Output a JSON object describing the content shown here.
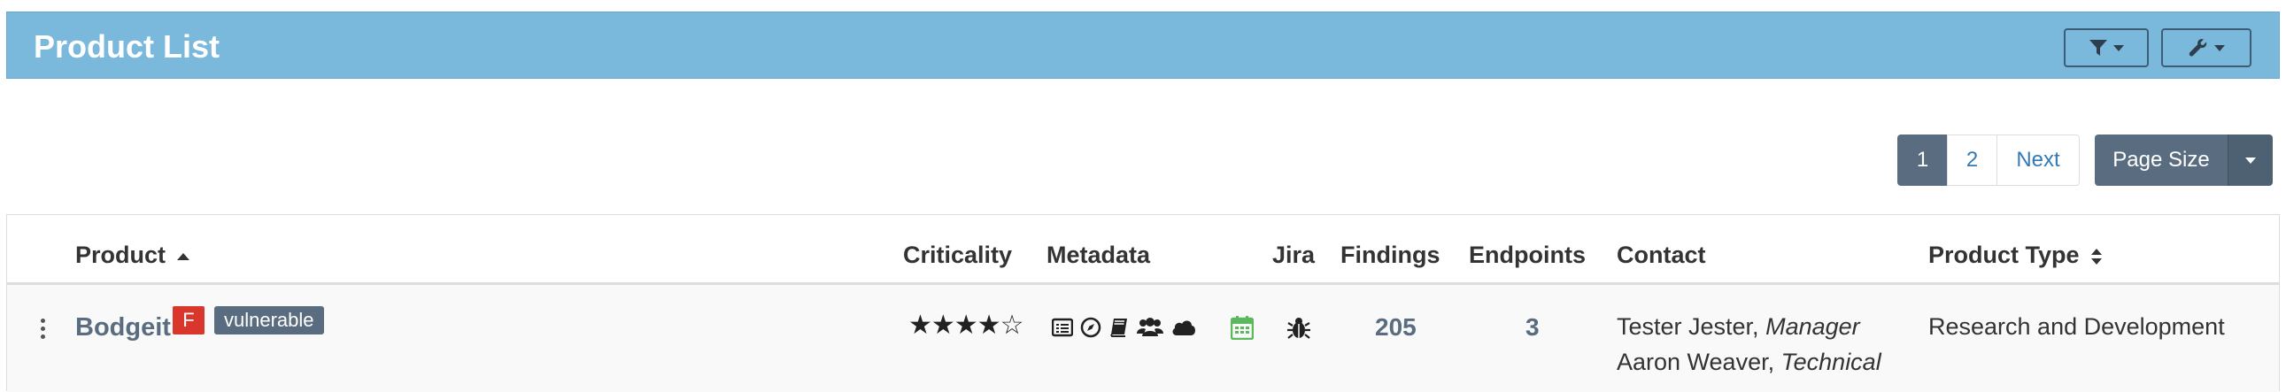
{
  "header": {
    "title": "Product List",
    "filter_icon": "filter-icon",
    "wrench_icon": "wrench-icon"
  },
  "pagination": {
    "pages": [
      "1",
      "2"
    ],
    "current": "1",
    "next_label": "Next",
    "page_size_label": "Page Size"
  },
  "table": {
    "columns": {
      "product": "Product",
      "criticality": "Criticality",
      "metadata": "Metadata",
      "jira": "Jira",
      "findings": "Findings",
      "endpoints": "Endpoints",
      "contact": "Contact",
      "product_type": "Product Type"
    },
    "rows": [
      {
        "name": "Bodgeit",
        "grade_badge": "F",
        "tag": "vulnerable",
        "criticality_stars": "★★★★☆",
        "criticality_level": 4,
        "criticality_max": 5,
        "findings": "205",
        "endpoints": "3",
        "contact_1_name": "Tester Jester,",
        "contact_1_role": "Manager",
        "contact_2_name": "Aaron Weaver,",
        "contact_2_role": "Technical",
        "product_type": "Research and Development"
      }
    ]
  },
  "colors": {
    "header_bg": "#7ab8dc",
    "accent": "#5a6d80",
    "badge_red": "#d9372b",
    "calendar_green": "#5cb85c"
  }
}
